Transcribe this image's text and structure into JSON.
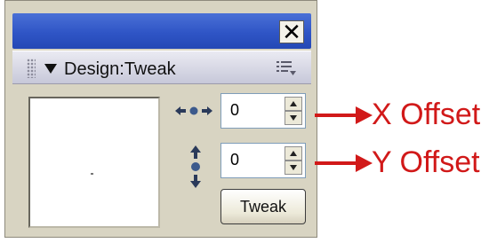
{
  "window": {
    "close_glyph": "✕"
  },
  "panel": {
    "title": "Design:Tweak",
    "menu_icon": "options-menu-icon"
  },
  "x_offset": {
    "icon": "horizontal-move-icon",
    "value": "0"
  },
  "y_offset": {
    "icon": "vertical-move-icon",
    "value": "0"
  },
  "tweak_button": {
    "label": "Tweak"
  },
  "callouts": {
    "x_label": "X Offset",
    "y_label": "Y Offset",
    "color": "#d11919"
  },
  "colors": {
    "titlebar": "#2f55c6",
    "panel_bg": "#d8d4c2"
  }
}
